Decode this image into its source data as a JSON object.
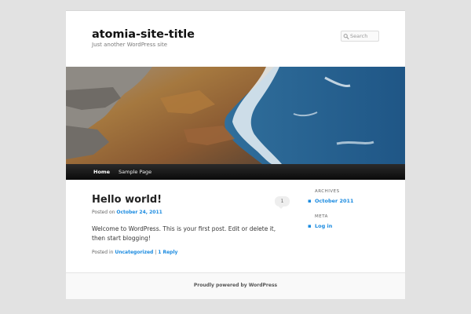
{
  "site": {
    "title": "atomia-site-title",
    "description": "Just another WordPress site"
  },
  "search": {
    "placeholder": "Search"
  },
  "nav": {
    "items": [
      {
        "label": "Home"
      },
      {
        "label": "Sample Page"
      }
    ]
  },
  "post": {
    "title": "Hello world!",
    "posted_on_label": "Posted on",
    "date": "October 24, 2011",
    "comment_count": "1",
    "content": "Welcome to WordPress. This is your first post. Edit or delete it, then start blogging!",
    "posted_in_label": "Posted in",
    "category": "Uncategorized",
    "separator": "|",
    "reply_link": "1 Reply"
  },
  "sidebar": {
    "archives": {
      "title": "ARCHIVES",
      "items": [
        "October 2011"
      ]
    },
    "meta": {
      "title": "META",
      "items": [
        "Log in"
      ]
    }
  },
  "footer": {
    "credit": "Proudly powered by WordPress"
  },
  "colors": {
    "background": "#e2e2e2",
    "link": "#1b8be0",
    "nav_bar": "#1a1a1a",
    "sea": "#2f6d9a",
    "rock": "#8a6a45"
  }
}
